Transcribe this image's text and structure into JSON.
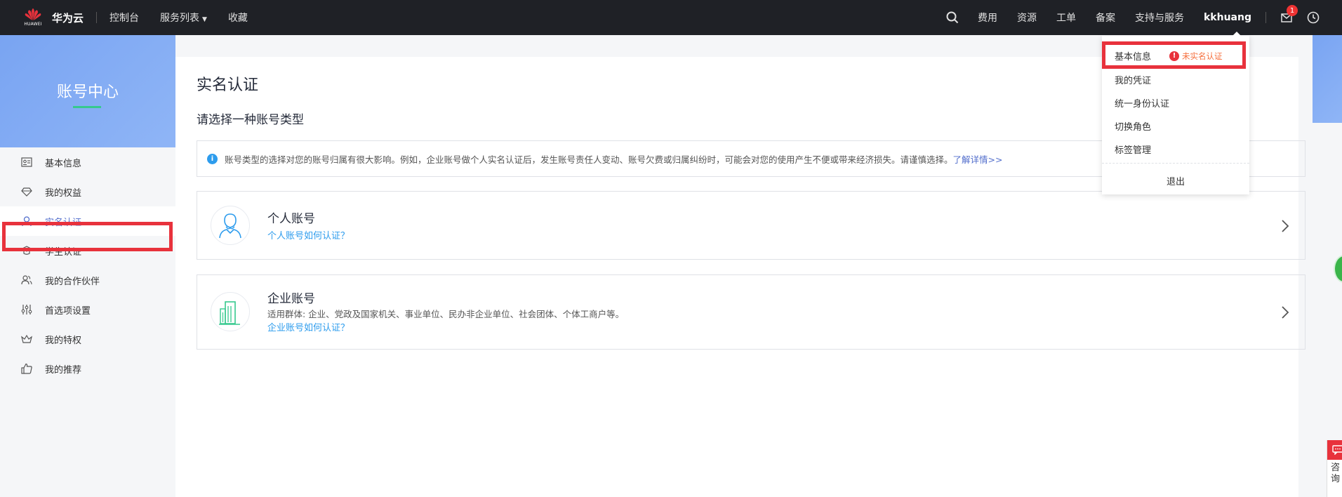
{
  "topbar": {
    "logo_sub": "HUAWEI",
    "brand": "华为云",
    "nav": [
      "控制台",
      "服务列表",
      "收藏"
    ],
    "right_links": [
      "费用",
      "资源",
      "工单",
      "备案",
      "支持与服务"
    ],
    "username": "kkhuang",
    "mail_count": "1",
    "icons": {
      "search": "search-icon",
      "mail": "mail-icon",
      "clock": "clock-icon"
    }
  },
  "sidebar": {
    "title": "账号中心",
    "items": [
      {
        "label": "基本信息",
        "icon": "profile-card-icon"
      },
      {
        "label": "我的权益",
        "icon": "diamond-icon"
      },
      {
        "label": "实名认证",
        "icon": "user-icon"
      },
      {
        "label": "学生认证",
        "icon": "graduation-cap-icon"
      },
      {
        "label": "我的合作伙伴",
        "icon": "partner-icon"
      },
      {
        "label": "首选项设置",
        "icon": "sliders-icon"
      },
      {
        "label": "我的特权",
        "icon": "crown-icon"
      },
      {
        "label": "我的推荐",
        "icon": "thumbs-up-icon"
      }
    ],
    "active_index": 2
  },
  "main": {
    "title": "实名认证",
    "subtitle": "请选择一种账号类型",
    "notice": "账号类型的选择对您的账号归属有很大影响。例如，企业账号做个人实名认证后，发生账号责任人变动、账号欠费或归属纠纷时，可能会对您的使用产生不便或带来经济损失。请谨慎选择。",
    "notice_link": "了解详情>>",
    "personal": {
      "name": "个人账号",
      "link": "个人账号如何认证？"
    },
    "enterprise": {
      "name": "企业账号",
      "desc": "适用群体: 企业、党政及国家机关、事业单位、民办非企业单位、社会团体、个体工商户等。",
      "link": "企业账号如何认证？"
    }
  },
  "dropdown": {
    "items": [
      "基本信息",
      "我的凭证",
      "统一身份认证",
      "切换角色",
      "标签管理"
    ],
    "badge": "未实名认证",
    "logout": "退出"
  },
  "floats": {
    "consult": "咨\n询"
  },
  "colors": {
    "accent_red": "#e8323c",
    "link_blue": "#2d9ced",
    "active_blue": "#526ecc",
    "topbar_bg": "#1f2126",
    "hero_green": "#36c98e"
  }
}
